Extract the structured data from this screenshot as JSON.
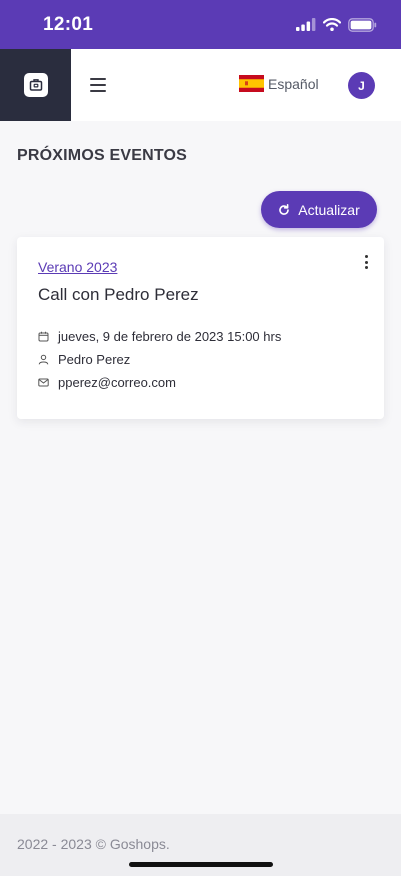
{
  "status_bar": {
    "time": "12:01",
    "icons": [
      "signal-icon",
      "wifi-icon",
      "battery-icon"
    ],
    "background": "#5b3bb5"
  },
  "topbar": {
    "logo_icon": "briefcase-icon",
    "menu_icon": "hamburger-icon",
    "language": {
      "label": "Español",
      "flag_icon": "spain-flag-icon"
    },
    "avatar_initial": "J"
  },
  "main": {
    "title": "PRÓXIMOS EVENTOS",
    "refresh_button": {
      "label": "Actualizar",
      "icon": "refresh-icon"
    },
    "events": [
      {
        "category": "Verano 2023",
        "title": "Call con Pedro Perez",
        "datetime": "jueves, 9 de febrero de 2023 15:00 hrs",
        "contact": "Pedro Perez",
        "email": "pperez@correo.com"
      }
    ]
  },
  "footer": {
    "text": "2022 - 2023 © Goshops."
  },
  "colors": {
    "accent": "#5b3bb5",
    "sidebar_dark": "#2a2d3e",
    "background": "#f7f7f9"
  }
}
